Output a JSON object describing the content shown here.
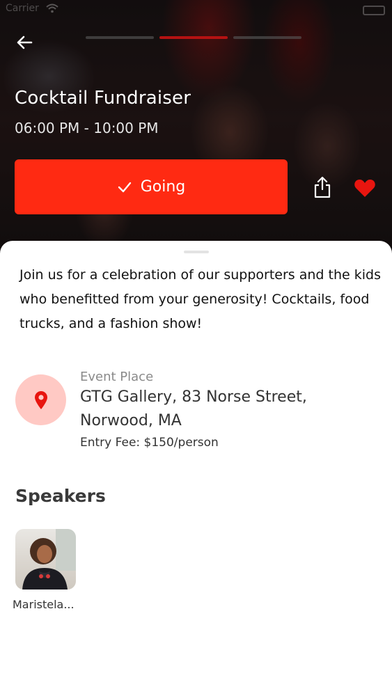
{
  "status_bar": {
    "carrier": "Carrier"
  },
  "event": {
    "title": "Cocktail Fundraiser",
    "time": "06:00 PM - 10:00 PM",
    "rsvp_label": "Going",
    "description": "Join us for a celebration of our supporters and the kids who benefitted from your generosity! Cocktails, food trucks, and a fashion show!",
    "place_label": "Event Place",
    "place_address": "GTG Gallery, 83 Norse Street, Norwood, MA",
    "entry_fee": "Entry Fee: $150/person"
  },
  "progress": {
    "segments": 3,
    "active_segment": 2
  },
  "speakers": {
    "heading": "Speakers",
    "items": [
      {
        "name": "Maristela..."
      }
    ]
  },
  "colors": {
    "accent": "#ff2a12",
    "pin_background": "#ffc9c4",
    "heart": "#e8150f"
  },
  "icons": [
    "wifi-icon",
    "battery-icon",
    "back-arrow-icon",
    "check-icon",
    "share-icon",
    "heart-icon",
    "location-pin-icon"
  ]
}
